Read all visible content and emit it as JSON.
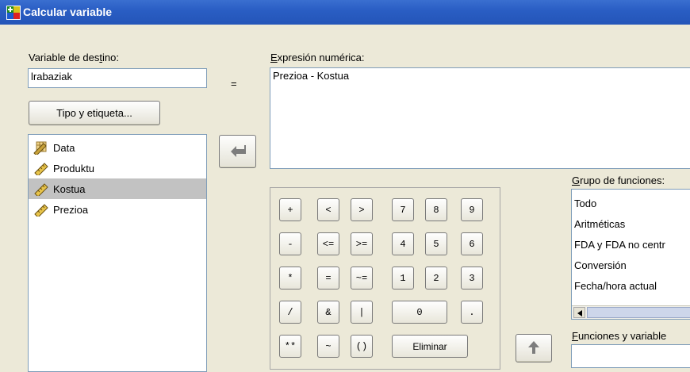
{
  "window": {
    "title": "Calcular variable"
  },
  "target": {
    "label_pre": "Variable de des",
    "label_ul": "t",
    "label_post": "ino:",
    "value": "lrabaziak",
    "equals": "="
  },
  "type_button": "Tipo y etiqueta...",
  "variables": [
    {
      "label": "Data",
      "icon": "date-icon",
      "selected": false
    },
    {
      "label": "Produktu",
      "icon": "ruler-icon",
      "selected": false
    },
    {
      "label": "Kostua",
      "icon": "ruler-icon",
      "selected": true
    },
    {
      "label": "Prezioa",
      "icon": "ruler-icon",
      "selected": false
    }
  ],
  "expression": {
    "label_ul": "E",
    "label_post": "xpresión numérica:",
    "value": "Prezioa - Kostua"
  },
  "keypad": {
    "row1": [
      "+",
      "<",
      ">",
      "7",
      "8",
      "9"
    ],
    "row2": [
      "-",
      "<=",
      ">=",
      "4",
      "5",
      "6"
    ],
    "row3": [
      "*",
      "=",
      "~=",
      "1",
      "2",
      "3"
    ],
    "row4": [
      "/",
      "&",
      "|",
      "0",
      "."
    ],
    "row5": [
      "**",
      "~",
      "()",
      "Eliminar"
    ]
  },
  "function_group": {
    "label_ul": "G",
    "label_post": "rupo de funciones:",
    "items": [
      "Todo",
      "Aritméticas",
      "FDA y FDA no centr",
      "Conversión",
      "Fecha/hora actual"
    ]
  },
  "functions_vars": {
    "label_ul": "F",
    "label_post": "unciones y variable"
  }
}
